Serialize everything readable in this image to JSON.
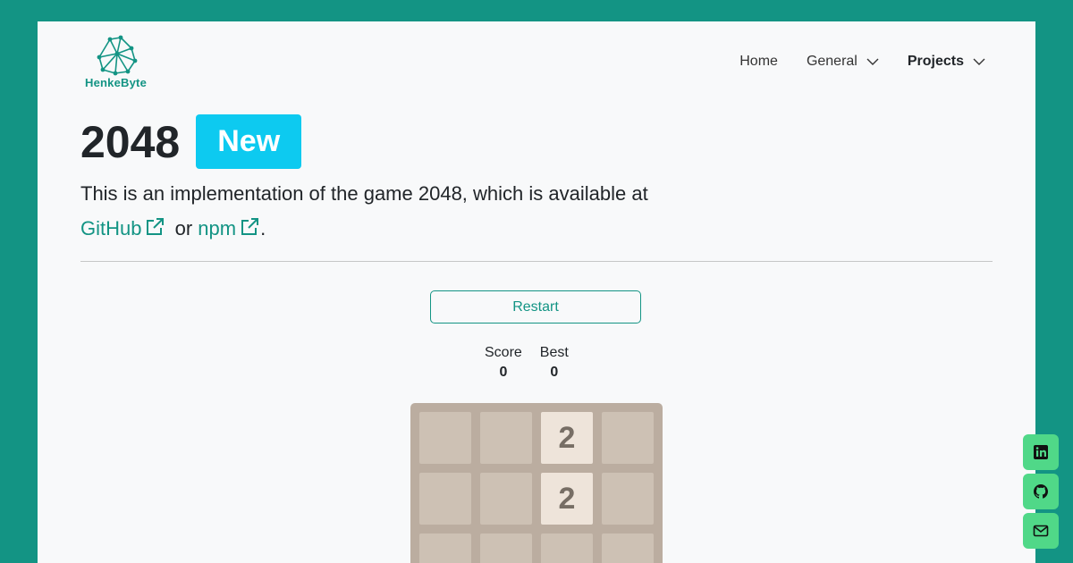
{
  "brand": {
    "name": "HenkeByte"
  },
  "nav": {
    "items": [
      {
        "label": "Home",
        "dropdown": false,
        "active": false
      },
      {
        "label": "General",
        "dropdown": true,
        "active": false
      },
      {
        "label": "Projects",
        "dropdown": true,
        "active": true
      }
    ]
  },
  "header": {
    "title": "2048",
    "badge": "New"
  },
  "description": {
    "text_before": "This is an implementation of the game 2048, which is available at",
    "link1": "GitHub",
    "or": "or",
    "link2": "npm",
    "period": "."
  },
  "game": {
    "restart_label": "Restart",
    "score_label": "Score",
    "score_value": "0",
    "best_label": "Best",
    "best_value": "0",
    "grid_visible": [
      [
        "",
        "",
        "2",
        ""
      ],
      [
        "",
        "",
        "2",
        ""
      ],
      [
        "",
        "",
        "",
        ""
      ]
    ]
  },
  "social": [
    "linkedin-icon",
    "github-icon",
    "mail-icon"
  ],
  "colors": {
    "accent": "#139484",
    "badge": "#0dcaf0",
    "social": "#50d888",
    "board": "#bbada0",
    "cell": "#cdc1b4",
    "tile2": "#eee4da"
  }
}
